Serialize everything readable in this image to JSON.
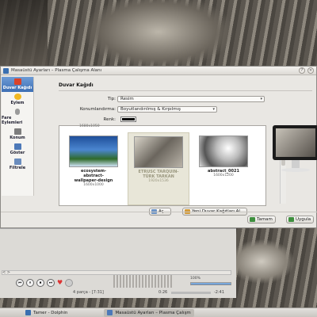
{
  "window": {
    "title": "Masaüstü Ayarları – Plasma Çalışma Alanı"
  },
  "sidebar": {
    "items": [
      {
        "label": "Duvar Kağıdı",
        "icon": "wallpaper-icon",
        "active": true
      },
      {
        "label": "Eylem",
        "icon": "action-icon",
        "active": false
      },
      {
        "label": "Fare Eylemleri",
        "icon": "mouse-icon",
        "active": false
      },
      {
        "label": "Konum",
        "icon": "location-icon",
        "active": false
      },
      {
        "label": "Göster",
        "icon": "display-icon",
        "active": false
      },
      {
        "label": "Filtrele",
        "icon": "filter-icon",
        "active": false
      }
    ]
  },
  "main": {
    "heading": "Duvar Kağıdı",
    "type_label": "Tip:",
    "type_value": "Resim",
    "positioning_label": "Konumlandırma:",
    "positioning_value": "Boyutlandırılmış & Kırpılmış",
    "color_label": "Renk:",
    "color_value": "#000000",
    "top_resolution": "1680x1050",
    "thumbnails": [
      {
        "name_lines": [
          "ecosystem-",
          "abstract-",
          "wallpaper-design"
        ],
        "size": "1600x1000",
        "selected": false
      },
      {
        "name_lines": [
          "ETRUSC TARQUIN-",
          "TÜRK TARKAN"
        ],
        "size": "1920x1536",
        "selected": true
      },
      {
        "name_lines": [
          "abstract_0021"
        ],
        "size": "1600x1200",
        "selected": false
      }
    ],
    "open_button": "Aç...",
    "new_wallpapers_button": "Yeni Duvar Kağıtları Al..."
  },
  "dialog_buttons": {
    "ok": "Tamam",
    "apply": "Uygula"
  },
  "player": {
    "track_info": "4 parça - [7:31]",
    "volume_label": "100%",
    "volume_fraction": 1.0,
    "time_elapsed": "0:26",
    "time_remaining": "-2:41"
  },
  "taskbar": {
    "items": [
      {
        "label": "Tamer - Dolphin",
        "active": false
      },
      {
        "label": "Masaüstü Ayarları – Plasma Çalışm",
        "active": true
      }
    ]
  },
  "colors": {
    "accent": "#3d6fb4",
    "selection": "#e8e6d8"
  }
}
